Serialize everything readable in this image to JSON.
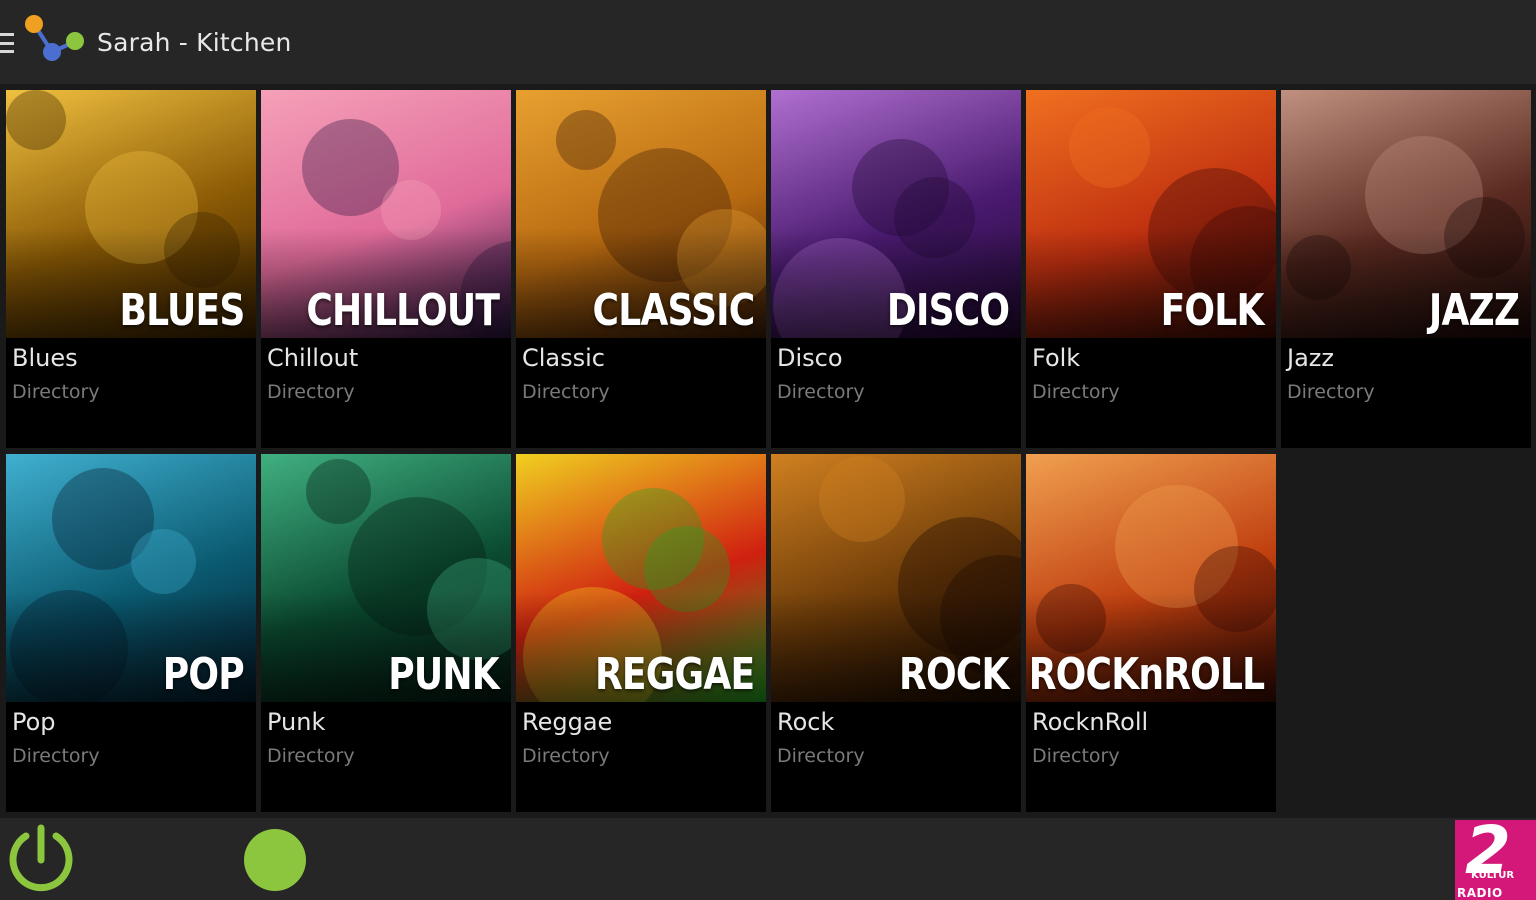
{
  "header": {
    "title": "Sarah - Kitchen",
    "menu_icon": "hamburger-menu-icon",
    "logo_icon": "speaker-network-logo-icon"
  },
  "genres": [
    {
      "big": "BLUES",
      "name": "Blues",
      "sub": "Directory",
      "colors": [
        "#8a5a05",
        "#f0c040",
        "#3a2200"
      ]
    },
    {
      "big": "CHILLOUT",
      "name": "Chillout",
      "sub": "Directory",
      "colors": [
        "#e06b9a",
        "#f5a0b8",
        "#2a1540"
      ]
    },
    {
      "big": "CLASSIC",
      "name": "Classic",
      "sub": "Directory",
      "colors": [
        "#b86a10",
        "#e8a030",
        "#3a1a05"
      ]
    },
    {
      "big": "DISCO",
      "name": "Disco",
      "sub": "Directory",
      "colors": [
        "#4a1a70",
        "#b070d0",
        "#200830"
      ]
    },
    {
      "big": "FOLK",
      "name": "Folk",
      "sub": "Directory",
      "colors": [
        "#c03010",
        "#f07020",
        "#3a0a05"
      ]
    },
    {
      "big": "JAZZ",
      "name": "Jazz",
      "sub": "Directory",
      "colors": [
        "#5a2a20",
        "#c09080",
        "#1a0a08"
      ]
    },
    {
      "big": "POP",
      "name": "Pop",
      "sub": "Directory",
      "colors": [
        "#0a5a70",
        "#40b0d0",
        "#051a2a"
      ]
    },
    {
      "big": "PUNK",
      "name": "Punk",
      "sub": "Directory",
      "colors": [
        "#0a4a30",
        "#40b080",
        "#051a10"
      ]
    },
    {
      "big": "REGGAE",
      "name": "Reggae",
      "sub": "Directory",
      "colors": [
        "#d02010",
        "#f0d020",
        "#20a020"
      ]
    },
    {
      "big": "ROCK",
      "name": "Rock",
      "sub": "Directory",
      "colors": [
        "#6a3a08",
        "#d08020",
        "#1a0a02"
      ]
    },
    {
      "big": "ROCKnROLL",
      "name": "RocknRoll",
      "sub": "Directory",
      "colors": [
        "#c04010",
        "#f0a050",
        "#3a0a02"
      ]
    }
  ],
  "footer": {
    "power_icon": "power-icon",
    "play_indicator": "status-dot",
    "accent_color": "#8cc63f",
    "radio_logo": {
      "number": "2",
      "small": "KULTUR",
      "label": "RADIO"
    }
  }
}
